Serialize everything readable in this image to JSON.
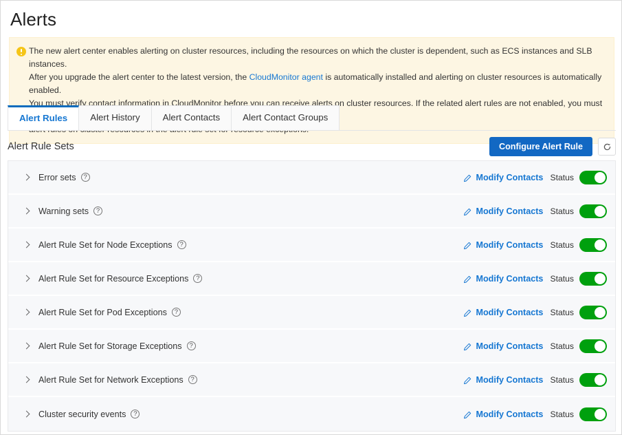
{
  "page": {
    "title": "Alerts"
  },
  "notice": {
    "icon": "warning-circle-icon",
    "line1": "The new alert center enables alerting on cluster resources, including the resources on which the cluster is dependent, such as ECS instances and SLB instances.",
    "line2_before": "After you upgrade the alert center to the latest version, the ",
    "line2_link": "CloudMonitor agent",
    "line2_after": " is automatically installed and alerting on cluster resources is automatically enabled.",
    "line3": "You must verify contact information in CloudMonitor before you can receive alerts on cluster resources. If the related alert rules are not enabled, you must enable the related",
    "line4": "alert rules on cluster resources in the alert rule set for resource exceptions.",
    "link_color": "#1677d2",
    "background_color": "#fdf6e3"
  },
  "tabs": [
    {
      "label": "Alert Rules",
      "active": true
    },
    {
      "label": "Alert History",
      "active": false
    },
    {
      "label": "Alert Contacts",
      "active": false
    },
    {
      "label": "Alert Contact Groups",
      "active": false
    }
  ],
  "section": {
    "title": "Alert Rule Sets",
    "configure_button": "Configure Alert Rule",
    "refresh_icon": "refresh-icon",
    "primary_color": "#1268c3"
  },
  "row_common": {
    "expand_icon": "chevron-right-icon",
    "help_icon": "?",
    "edit_icon": "pencil-icon",
    "modify_label": "Modify Contacts",
    "status_label": "Status",
    "toggle_on_color": "#00a00e"
  },
  "rule_sets": [
    {
      "name": "Error sets",
      "status_on": true
    },
    {
      "name": "Warning sets",
      "status_on": true
    },
    {
      "name": "Alert Rule Set for Node Exceptions",
      "status_on": true
    },
    {
      "name": "Alert Rule Set for Resource Exceptions",
      "status_on": true
    },
    {
      "name": "Alert Rule Set for Pod Exceptions",
      "status_on": true
    },
    {
      "name": "Alert Rule Set for Storage Exceptions",
      "status_on": true
    },
    {
      "name": "Alert Rule Set for Network Exceptions",
      "status_on": true
    },
    {
      "name": "Cluster security events",
      "status_on": true
    }
  ]
}
